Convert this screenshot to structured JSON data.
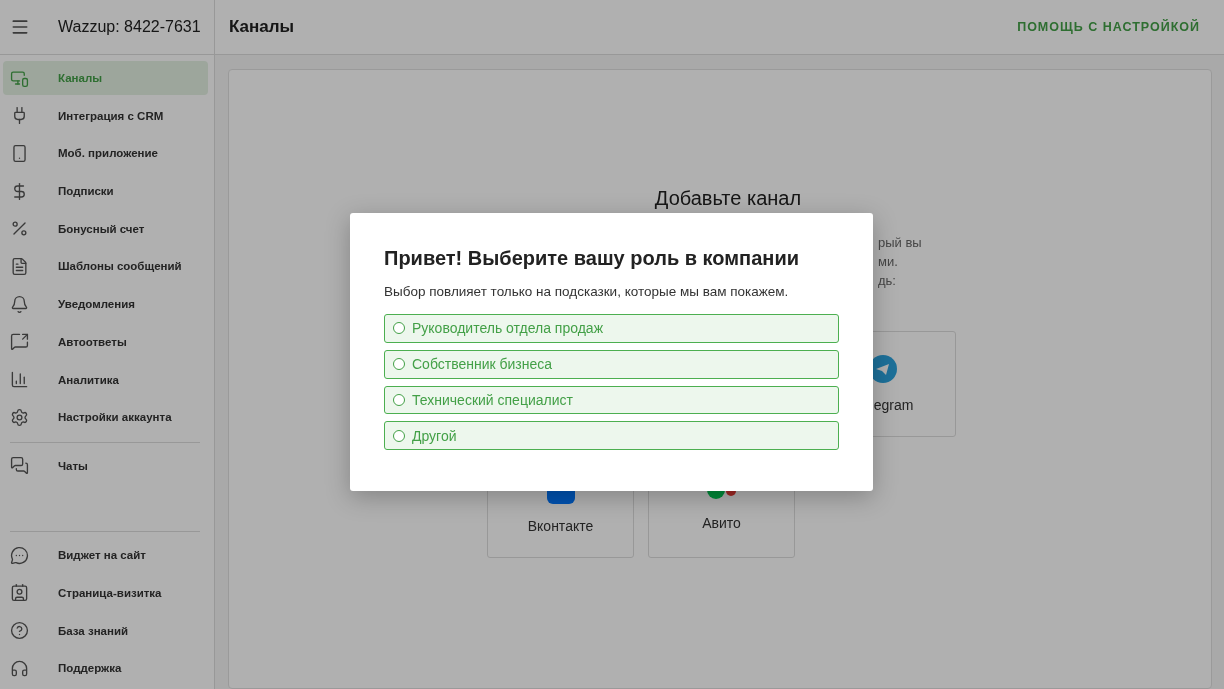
{
  "sidebar": {
    "account": "Wazzup: 8422-7631",
    "items": [
      {
        "label": "Каналы",
        "selected": true
      },
      {
        "label": "Интеграция с CRM",
        "selected": false
      },
      {
        "label": "Моб. приложение",
        "selected": false
      },
      {
        "label": "Подписки",
        "selected": false
      },
      {
        "label": "Бонусный счет",
        "selected": false
      },
      {
        "label": "Шаблоны сообщений",
        "selected": false
      },
      {
        "label": "Уведомления",
        "selected": false
      },
      {
        "label": "Автоответы",
        "selected": false
      },
      {
        "label": "Аналитика",
        "selected": false
      },
      {
        "label": "Настройки аккаунта",
        "selected": false
      }
    ],
    "chat_items": [
      {
        "label": "Чаты",
        "selected": false
      }
    ],
    "bottom_items": [
      {
        "label": "Виджет на сайт",
        "selected": false
      },
      {
        "label": "Страница-визитка",
        "selected": false
      },
      {
        "label": "База знаний",
        "selected": false
      },
      {
        "label": "Поддержка",
        "selected": false
      }
    ]
  },
  "header": {
    "title": "Каналы",
    "help_link": "ПОМОЩЬ С НАСТРОЙКОЙ"
  },
  "content": {
    "title": "Добавьте канал",
    "description_fragments": [
      "рый вы",
      "ми.",
      "дь:"
    ],
    "channel_cards": [
      {
        "kind": "telegram",
        "label": "egram"
      },
      {
        "kind": "vk",
        "label": "Вконтакте"
      },
      {
        "kind": "avito",
        "label": "Авито"
      }
    ]
  },
  "dialog": {
    "title": "Привет! Выберите вашу роль в компании",
    "subtitle": "Выбор повлияет только на подсказки, которые мы вам покажем.",
    "options": [
      {
        "label": "Руководитель отдела продаж",
        "selected": false
      },
      {
        "label": "Собственник бизнеса",
        "selected": false
      },
      {
        "label": "Технический специалист",
        "selected": false
      },
      {
        "label": "Другой",
        "selected": false
      }
    ]
  }
}
